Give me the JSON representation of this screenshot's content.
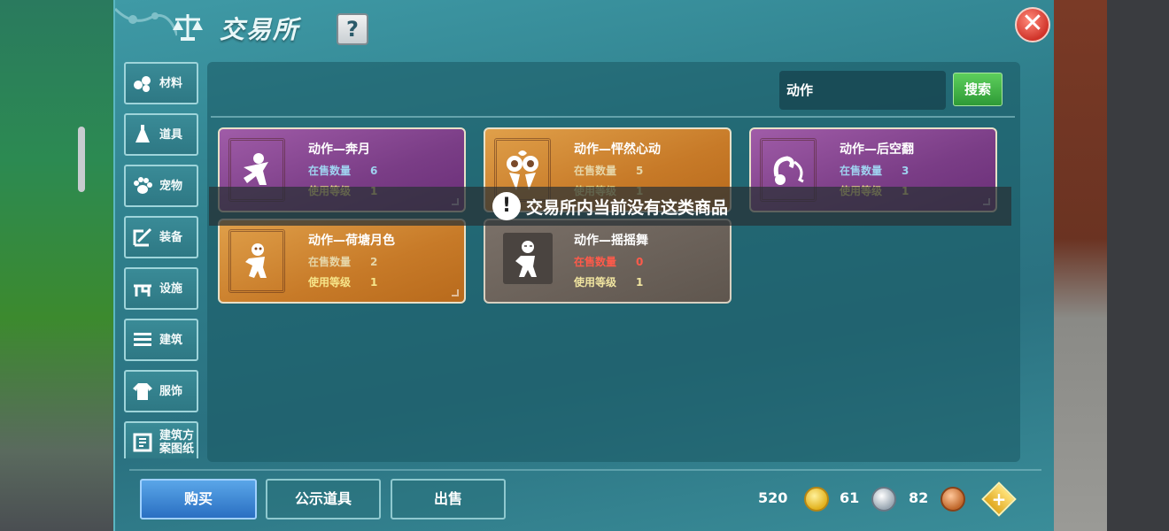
{
  "window": {
    "title": "交易所",
    "help_label": "?",
    "close_label": "✕"
  },
  "sidebar": {
    "items": [
      {
        "label": "材料",
        "icon": "materials-icon"
      },
      {
        "label": "道具",
        "icon": "item-icon"
      },
      {
        "label": "宠物",
        "icon": "pet-paw-icon"
      },
      {
        "label": "装备",
        "icon": "equipment-icon"
      },
      {
        "label": "设施",
        "icon": "facility-icon"
      },
      {
        "label": "建筑",
        "icon": "building-icon"
      },
      {
        "label": "服饰",
        "icon": "clothing-icon"
      },
      {
        "label": "建筑方\n案图纸",
        "icon": "blueprint-icon"
      }
    ]
  },
  "search": {
    "value": "动作",
    "button_label": "搜索"
  },
  "cards": [
    {
      "name": "动作—奔月",
      "stock_label": "在售数量",
      "stock": "6",
      "level_label": "使用等级",
      "level": "1",
      "style": "purple"
    },
    {
      "name": "动作—怦然心动",
      "stock_label": "在售数量",
      "stock": "5",
      "level_label": "使用等级",
      "level": "1",
      "style": "orange"
    },
    {
      "name": "动作—后空翻",
      "stock_label": "在售数量",
      "stock": "3",
      "level_label": "使用等级",
      "level": "1",
      "style": "purple"
    },
    {
      "name": "动作—荷塘月色",
      "stock_label": "在售数量",
      "stock": "2",
      "level_label": "使用等级",
      "level": "1",
      "style": "orange"
    },
    {
      "name": "动作—摇摇舞",
      "stock_label": "在售数量",
      "stock": "0",
      "level_label": "使用等级",
      "level": "1",
      "style": "gray"
    }
  ],
  "toast": {
    "text": "交易所内当前没有这类商品"
  },
  "bottom_tabs": {
    "buy": "购买",
    "showcase": "公示道具",
    "sell": "出售"
  },
  "currency": {
    "gold": "520",
    "silver": "61",
    "copper": "82",
    "add_label": "+"
  },
  "colors": {
    "panel": "#2f7f8c",
    "card_purple": "#7a3d86",
    "card_orange": "#c77a28",
    "card_gray": "#5f564e",
    "buy_button": "#2a6fc2",
    "search_button": "#2e9a36",
    "close_button": "#d0342a"
  }
}
